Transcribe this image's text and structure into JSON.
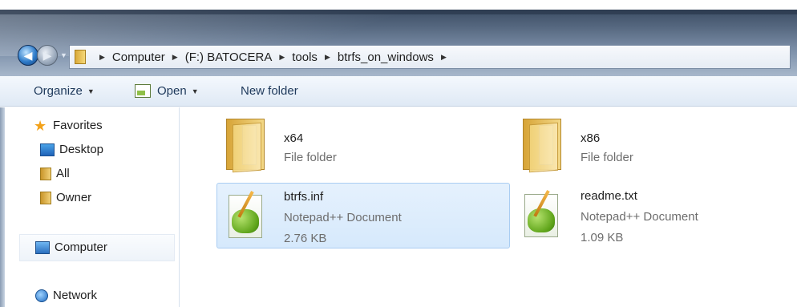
{
  "address": {
    "crumbs": [
      "Computer",
      "(F:) BATOCERA",
      "tools",
      "btrfs_on_windows"
    ]
  },
  "toolbar": {
    "organize": "Organize",
    "open": "Open",
    "new_folder": "New folder"
  },
  "nav": {
    "favorites": "Favorites",
    "desktop": "Desktop",
    "all": "All",
    "owner": "Owner",
    "computer": "Computer",
    "network": "Network"
  },
  "files": [
    {
      "name": "x64",
      "type": "File folder",
      "size": ""
    },
    {
      "name": "x86",
      "type": "File folder",
      "size": ""
    },
    {
      "name": "btrfs.inf",
      "type": "Notepad++ Document",
      "size": "2.76 KB"
    },
    {
      "name": "readme.txt",
      "type": "Notepad++ Document",
      "size": "1.09 KB"
    }
  ],
  "icons": {
    "back": "back-arrow-icon",
    "forward": "forward-arrow-icon",
    "folder": "folder-icon",
    "notepadpp": "notepadpp-document-icon",
    "favorites": "star-icon",
    "desktop": "desktop-icon",
    "library": "library-icon",
    "computer": "computer-icon",
    "network": "network-icon"
  },
  "colors": {
    "selection_bg": "#d6e9fc",
    "selection_border": "#aacdf2",
    "command_text": "#1e395b"
  }
}
